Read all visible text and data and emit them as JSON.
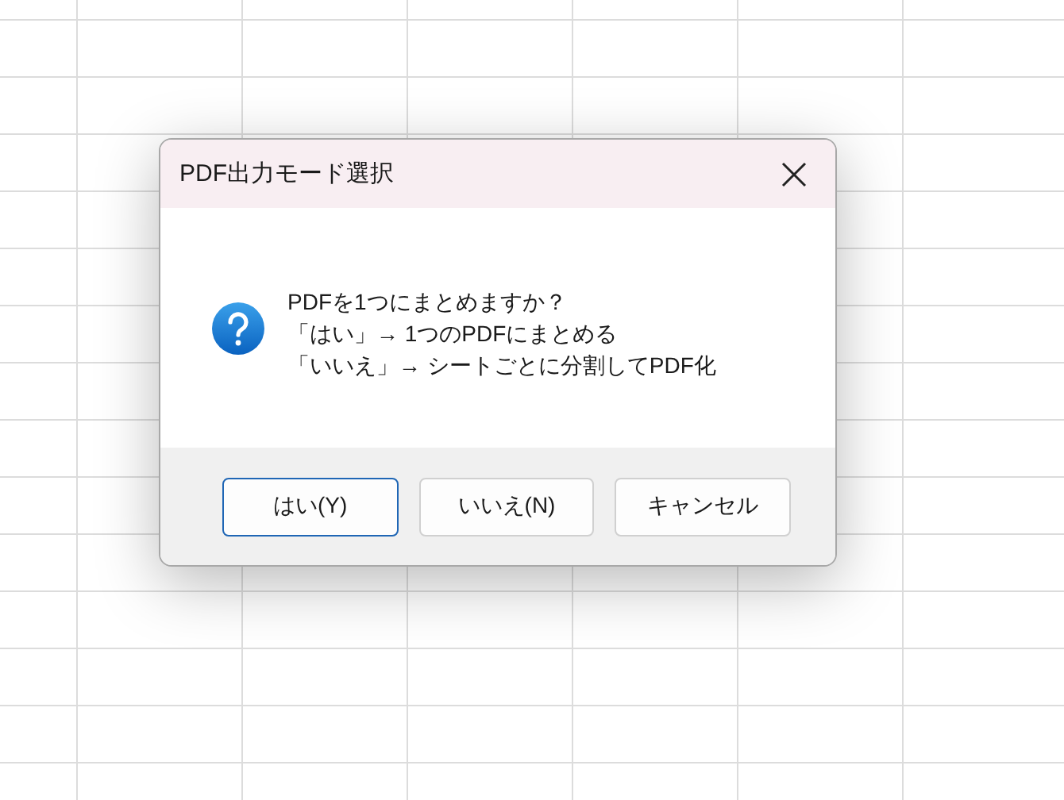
{
  "dialog": {
    "title": "PDF出力モード選択",
    "message": [
      "PDFを1つにまとめますか？",
      "「はい」→ 1つのPDFにまとめる",
      "「いいえ」→ シートごとに分割してPDF化"
    ],
    "buttons": [
      {
        "label": "はい(Y)",
        "default": true
      },
      {
        "label": "いいえ(N)",
        "default": false
      },
      {
        "label": "キャンセル",
        "default": false
      }
    ]
  }
}
